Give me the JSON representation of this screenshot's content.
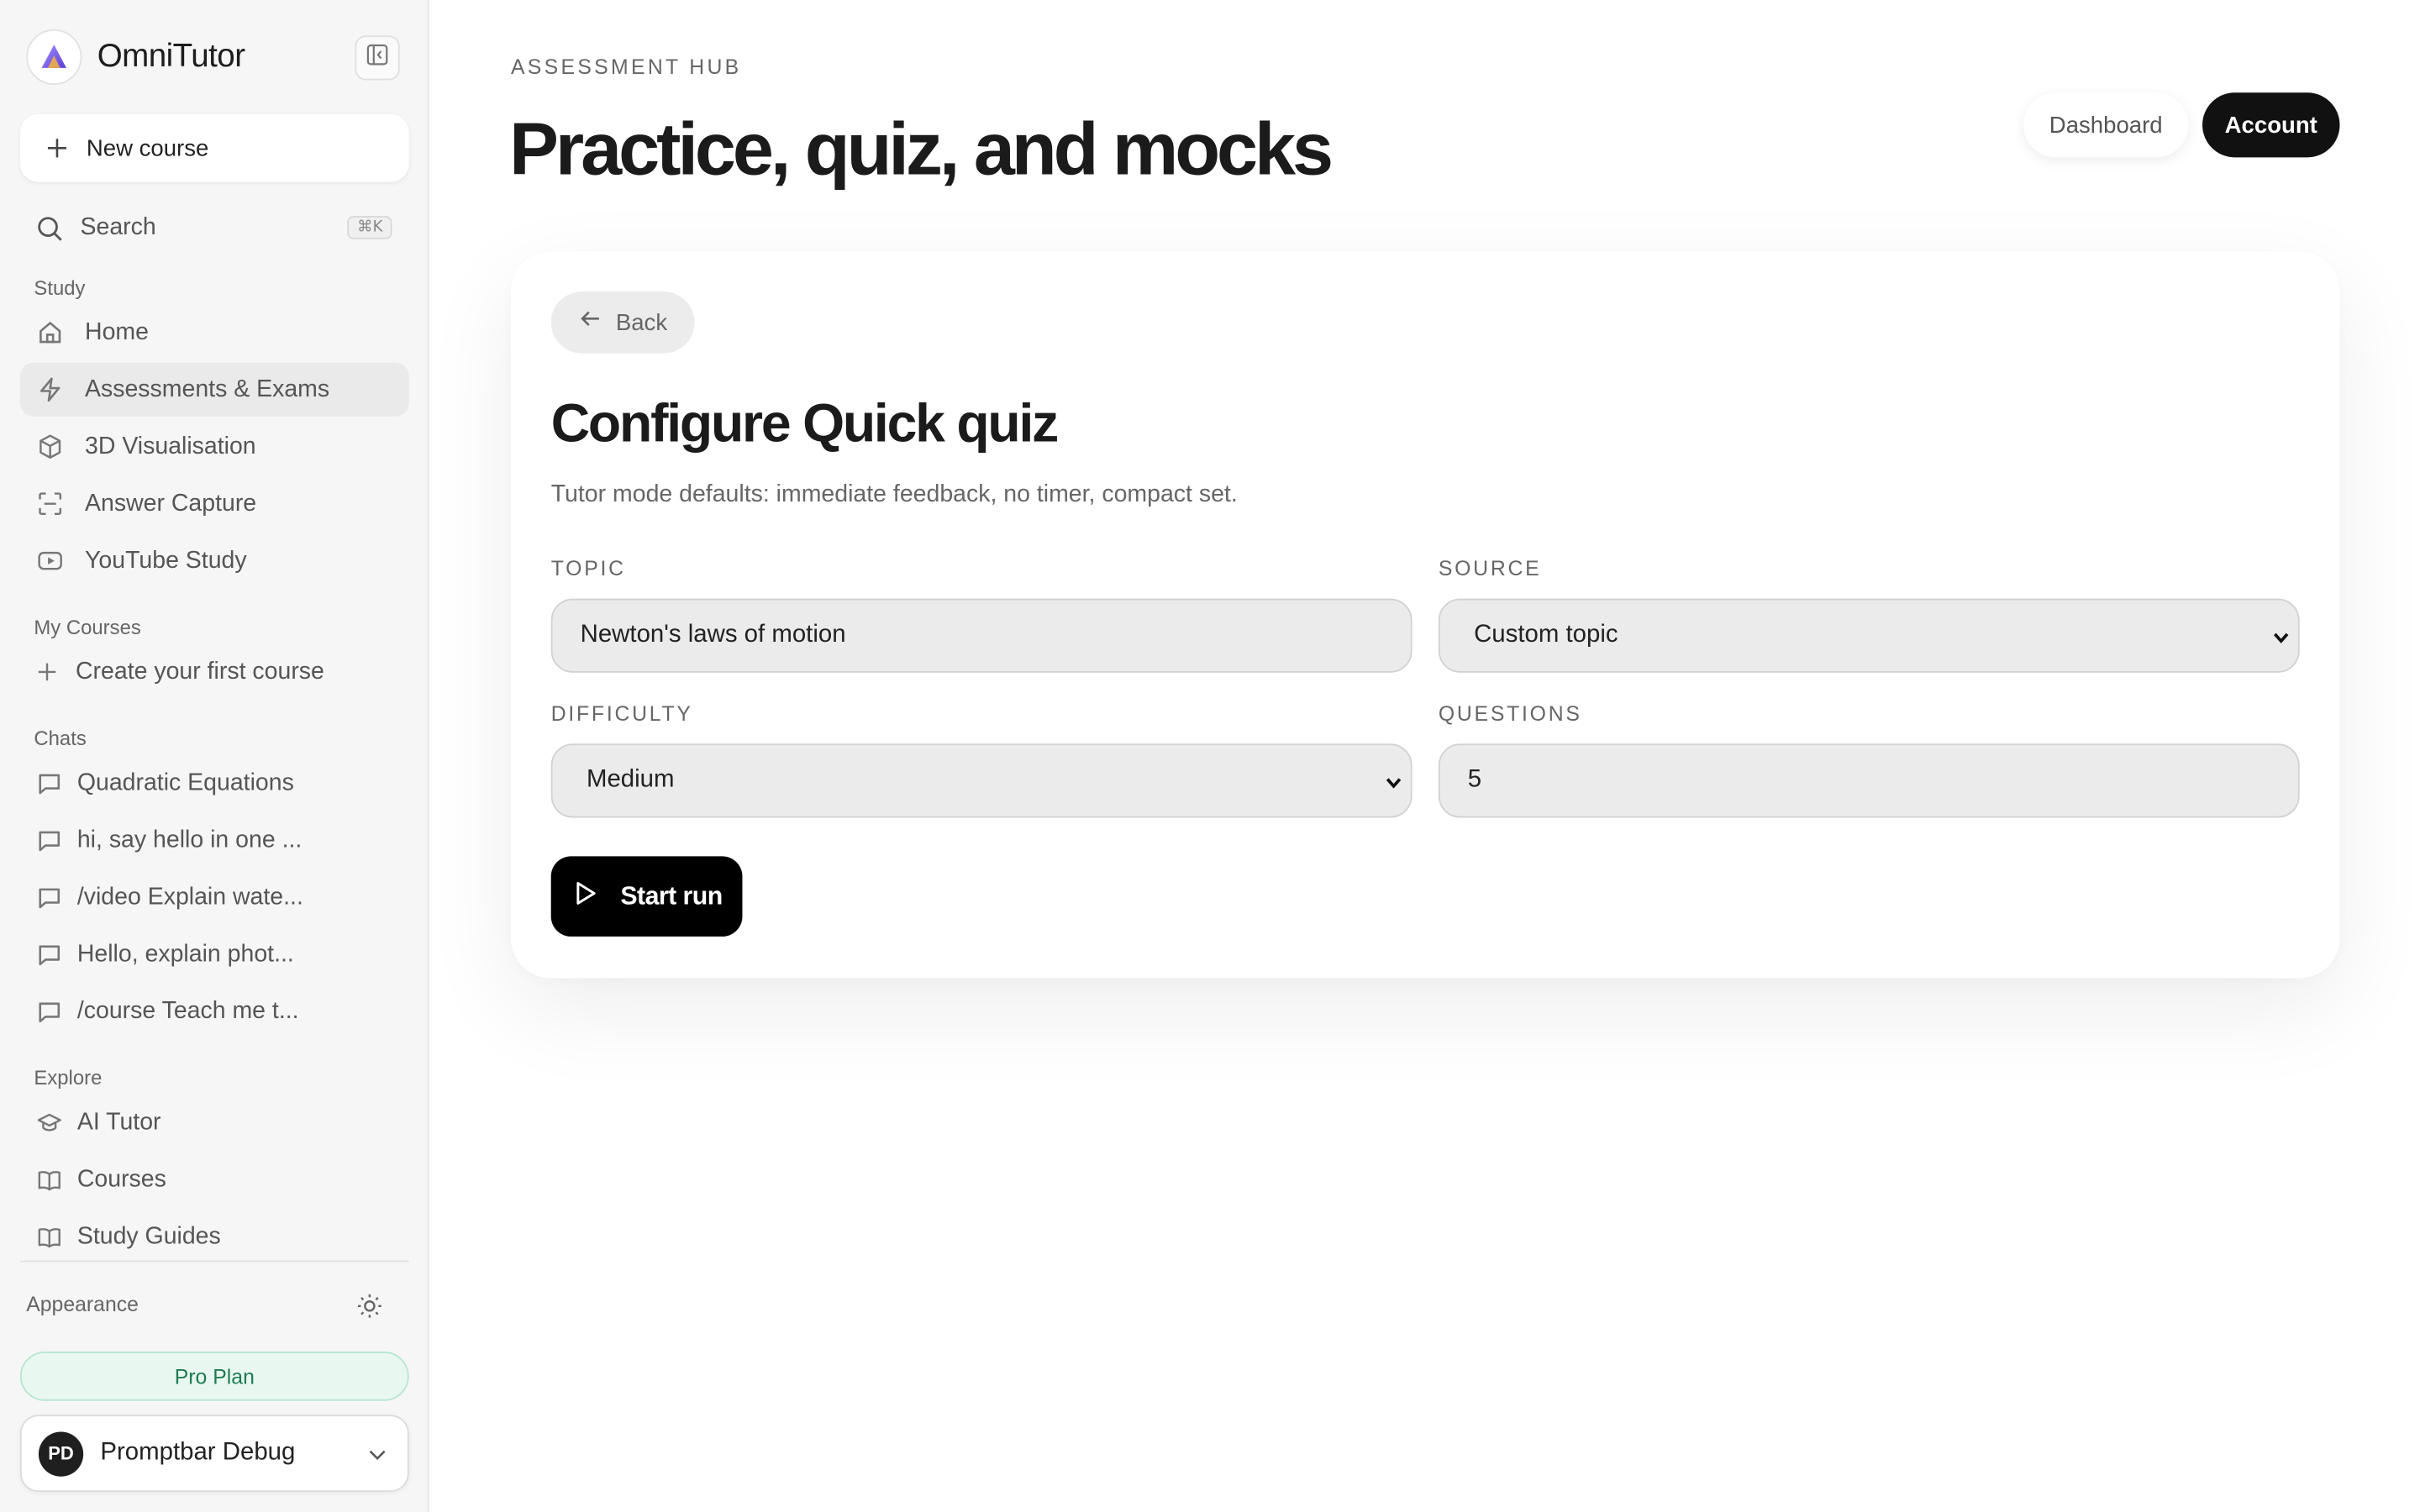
{
  "app": {
    "name": "OmniTutor"
  },
  "sidebar": {
    "new_course": "New course",
    "search": {
      "label": "Search",
      "shortcut": "⌘K"
    },
    "study": {
      "label": "Study",
      "items": [
        {
          "label": "Home",
          "icon": "home-icon"
        },
        {
          "label": "Assessments & Exams",
          "icon": "lightning-icon",
          "active": true
        },
        {
          "label": "3D Visualisation",
          "icon": "cube-icon"
        },
        {
          "label": "Answer Capture",
          "icon": "scan-icon"
        },
        {
          "label": "YouTube Study",
          "icon": "youtube-icon"
        }
      ]
    },
    "my_courses": {
      "label": "My Courses",
      "create": "Create your first course"
    },
    "chats": {
      "label": "Chats",
      "items": [
        {
          "label": "Quadratic Equations"
        },
        {
          "label": "hi, say hello in one ..."
        },
        {
          "label": "/video Explain wate..."
        },
        {
          "label": "Hello, explain phot..."
        },
        {
          "label": "/course Teach me t..."
        }
      ]
    },
    "explore": {
      "label": "Explore",
      "items": [
        {
          "label": "AI Tutor",
          "icon": "graduation-cap-icon"
        },
        {
          "label": "Courses",
          "icon": "book-icon"
        },
        {
          "label": "Study Guides",
          "icon": "book-icon"
        }
      ]
    },
    "appearance": "Appearance",
    "plan": "Pro Plan",
    "user": {
      "initials": "PD",
      "name": "Promptbar Debug"
    }
  },
  "header": {
    "eyebrow": "ASSESSMENT HUB",
    "title": "Practice, quiz, and mocks",
    "dashboard": "Dashboard",
    "account": "Account"
  },
  "card": {
    "back": "Back",
    "title": "Configure Quick quiz",
    "subtitle": "Tutor mode defaults: immediate feedback, no timer, compact set.",
    "topic": {
      "label": "TOPIC",
      "value": "Newton's laws of motion"
    },
    "source": {
      "label": "SOURCE",
      "value": "Custom topic"
    },
    "difficulty": {
      "label": "DIFFICULTY",
      "value": "Medium"
    },
    "questions": {
      "label": "QUESTIONS",
      "value": "5"
    },
    "start": "Start run"
  },
  "colors": {
    "accent_dark": "#111111",
    "plan_bg": "#e8f8f1",
    "plan_text": "#1f7a53",
    "logo_purple": "#7b5cf0"
  }
}
